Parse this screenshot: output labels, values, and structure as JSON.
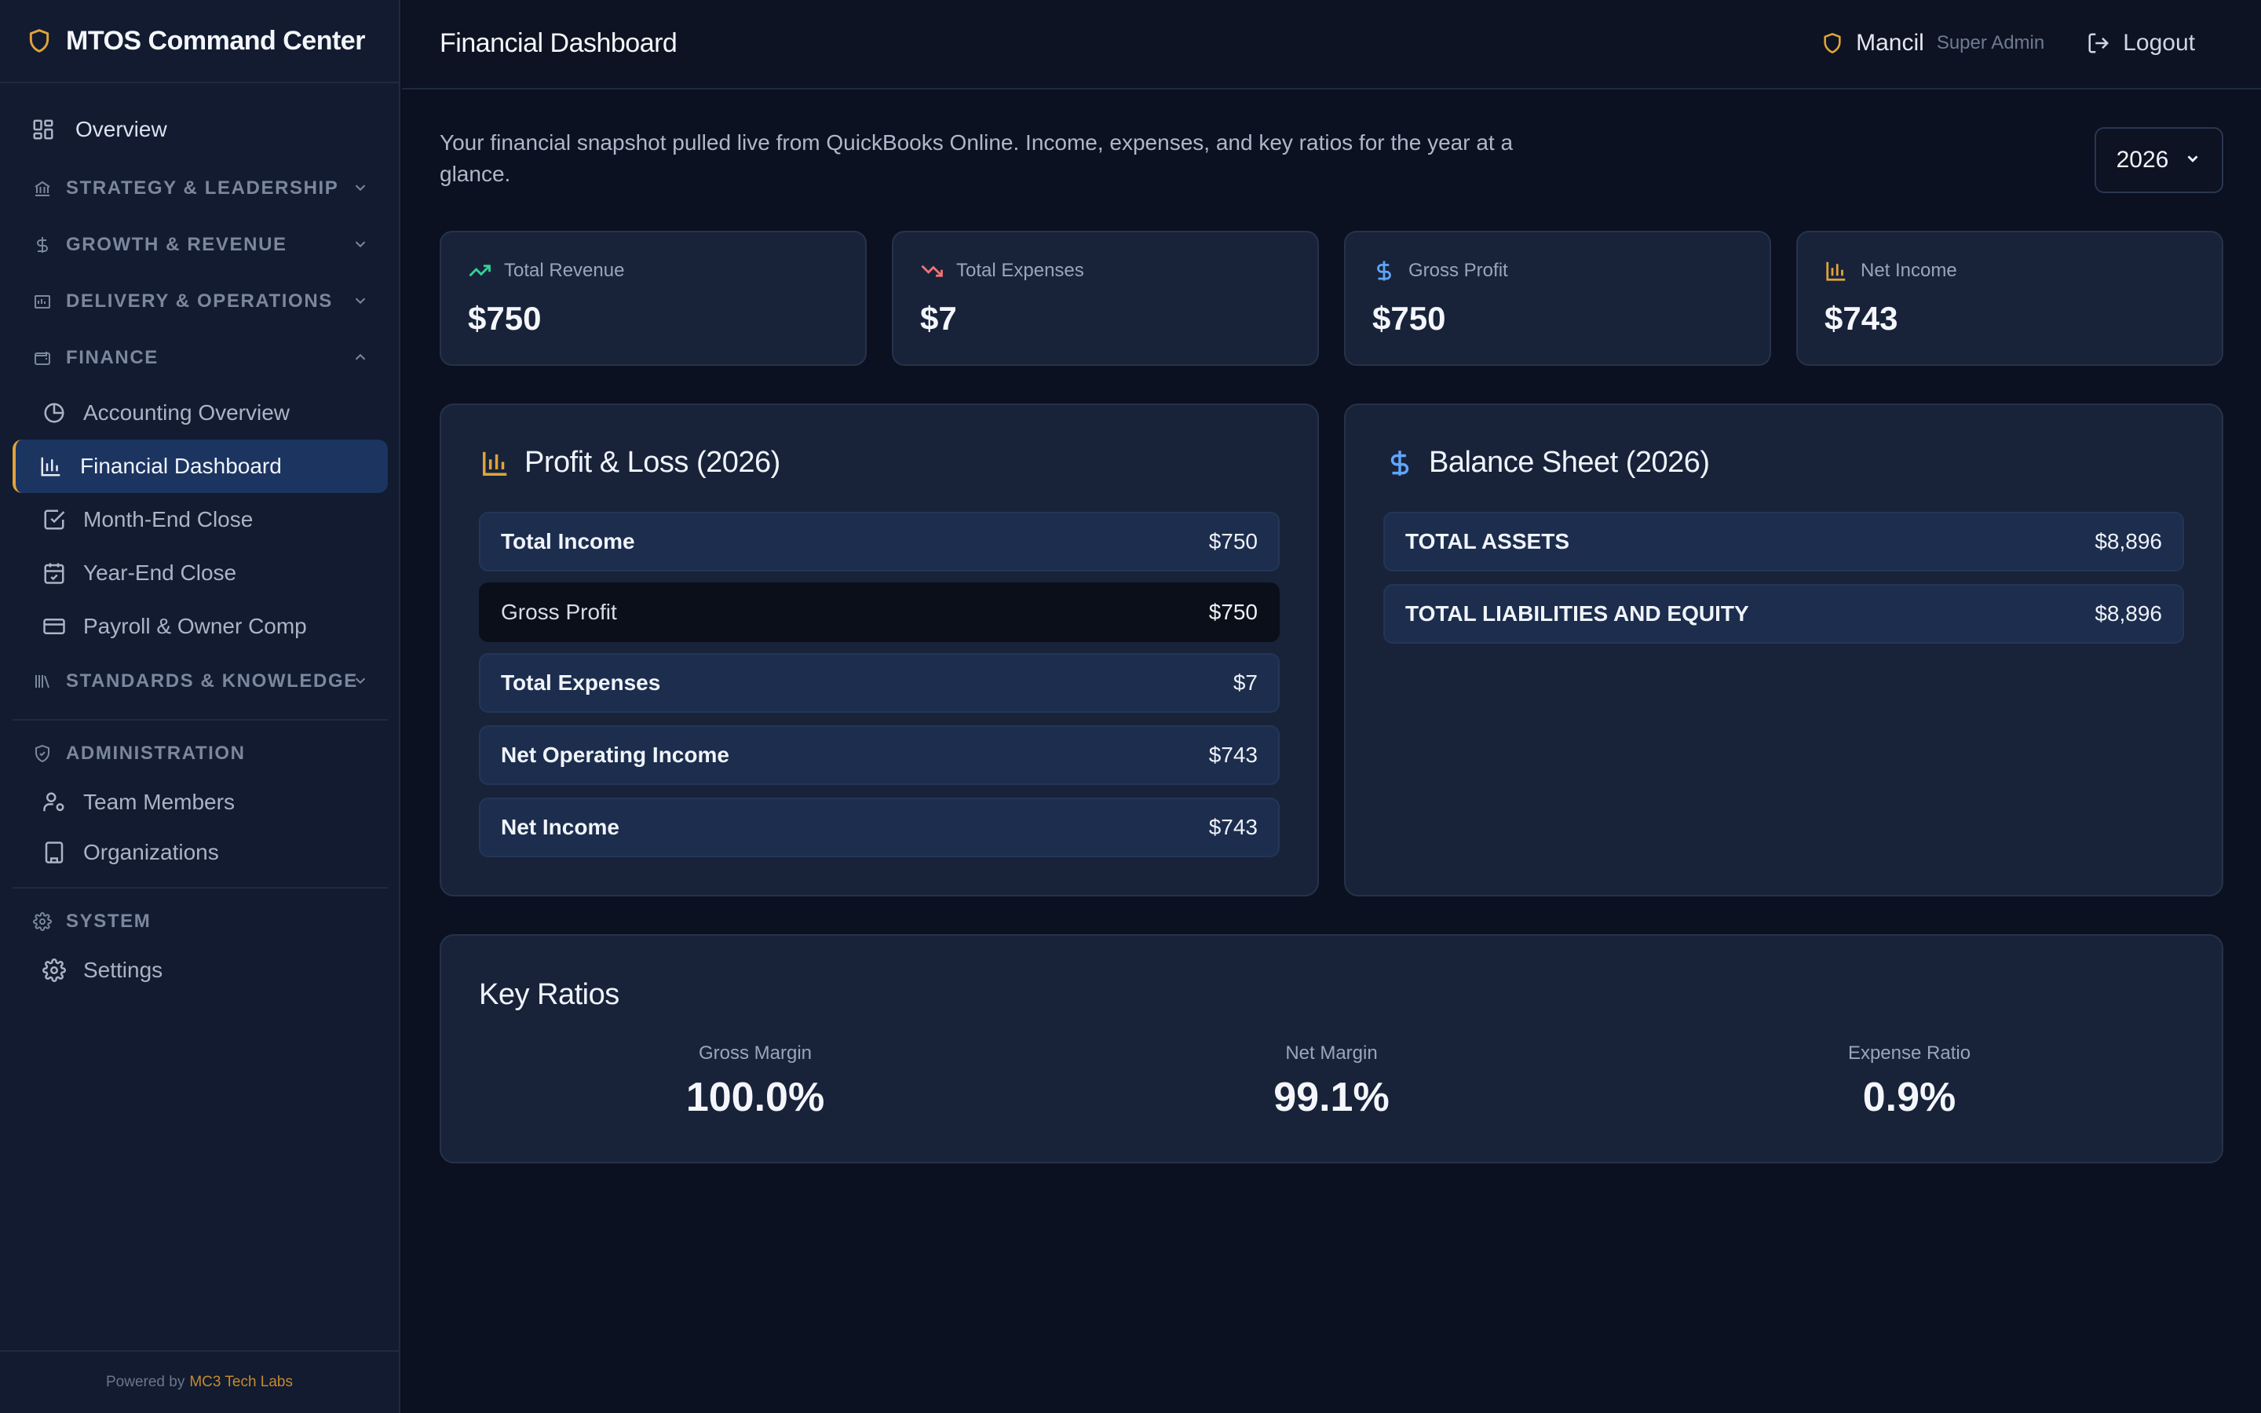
{
  "brand": {
    "title": "MTOS Command Center"
  },
  "nav": {
    "overview": "Overview",
    "sections": {
      "strategy": "STRATEGY & LEADERSHIP",
      "growth": "GROWTH & REVENUE",
      "delivery": "DELIVERY & OPERATIONS",
      "finance": "FINANCE",
      "standards": "STANDARDS & KNOWLEDGE",
      "administration": "ADMINISTRATION",
      "system": "SYSTEM"
    },
    "finance_items": [
      "Accounting Overview",
      "Financial Dashboard",
      "Month-End Close",
      "Year-End Close",
      "Payroll & Owner Comp"
    ],
    "admin_items": [
      "Team Members",
      "Organizations"
    ],
    "system_items": [
      "Settings"
    ],
    "active_item": "Financial Dashboard"
  },
  "footer": {
    "powered_by": "Powered by",
    "company": "MC3 Tech Labs"
  },
  "header": {
    "title": "Financial Dashboard",
    "user_name": "Mancil",
    "user_role": "Super Admin",
    "logout": "Logout"
  },
  "main": {
    "intro": "Your financial snapshot pulled live from QuickBooks Online. Income, expenses, and key ratios for the year at a glance.",
    "year_select": "2026",
    "stats": [
      {
        "label": "Total Revenue",
        "value": "$750"
      },
      {
        "label": "Total Expenses",
        "value": "$7"
      },
      {
        "label": "Gross Profit",
        "value": "$750"
      },
      {
        "label": "Net Income",
        "value": "$743"
      }
    ],
    "pnl": {
      "title": "Profit & Loss (2026)",
      "rows": [
        {
          "label": "Total Income",
          "value": "$750"
        },
        {
          "label": "Gross Profit",
          "value": "$750"
        },
        {
          "label": "Total Expenses",
          "value": "$7"
        },
        {
          "label": "Net Operating Income",
          "value": "$743"
        },
        {
          "label": "Net Income",
          "value": "$743"
        }
      ]
    },
    "balance": {
      "title": "Balance Sheet (2026)",
      "rows": [
        {
          "label": "TOTAL ASSETS",
          "value": "$8,896"
        },
        {
          "label": "TOTAL LIABILITIES AND EQUITY",
          "value": "$8,896"
        }
      ]
    },
    "ratios": {
      "title": "Key Ratios",
      "items": [
        {
          "label": "Gross Margin",
          "value": "100.0%"
        },
        {
          "label": "Net Margin",
          "value": "99.1%"
        },
        {
          "label": "Expense Ratio",
          "value": "0.9%"
        }
      ]
    }
  },
  "colors": {
    "accent": "#e0a43a",
    "active_bg": "#1c3460",
    "green": "#34d399",
    "red": "#f87171",
    "blue": "#60a5fa"
  }
}
